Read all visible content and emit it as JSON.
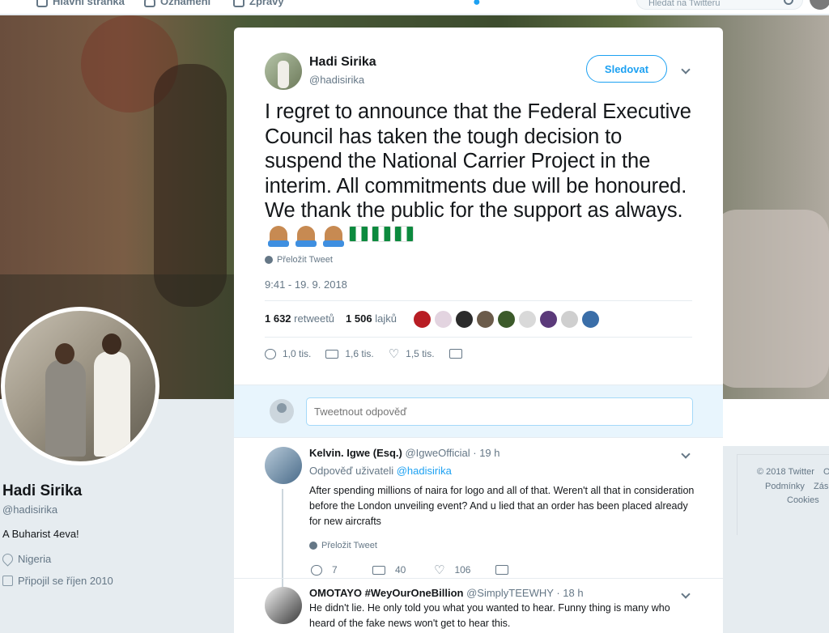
{
  "nav": {
    "home": "Hlavní stránka",
    "notifications": "Oznámení",
    "messages": "Zprávy",
    "search_placeholder": "Hledat na Twitteru"
  },
  "profile": {
    "name": "Hadi Sirika",
    "handle": "@hadisirika",
    "bio": "A Buharist 4eva!",
    "location": "Nigeria",
    "joined": "Připojil se říjen 2010"
  },
  "footer": {
    "line1": "© 2018 Twitter",
    "line1b": "O",
    "line2": "Podmínky",
    "line2b": "Zás",
    "line3": "Cookies"
  },
  "tweet": {
    "author_name": "Hadi Sirika",
    "author_handle": "@hadisirika",
    "follow_label": "Sledovat",
    "text": "I regret to announce that the Federal Executive Council has taken the tough decision to suspend the National Carrier Project in the interim. All commitments due will be honoured. We thank the public for the support as always.",
    "translate_label": "Přeložit Tweet",
    "timestamp": "9:41 - 19. 9. 2018",
    "retweets_count": "1 632",
    "retweets_label": "retweetů",
    "likes_count": "1 506",
    "likes_label": "lajků",
    "replies_action": "1,0 tis.",
    "retweets_action": "1,6 tis.",
    "likes_action": "1,5 tis.",
    "liker_colors": [
      "#b81d24",
      "#e3d4e0",
      "#2b2b2b",
      "#6b5b4a",
      "#3c5a2a",
      "#d9d9d9",
      "#5b3a7a",
      "#cfcfcf",
      "#3a6ea8"
    ]
  },
  "reply_box": {
    "placeholder": "Tweetnout odpověď"
  },
  "replies": [
    {
      "name": "Kelvin. Igwe (Esq.)",
      "handle": "@IgweOfficial",
      "time": "· 19 h",
      "replying_prefix": "Odpověď uživateli",
      "replying_to": "@hadisirika",
      "text": "After spending millions of naira for logo and all of that. Weren't all that in consideration before the London unveiling event? And u lied that an order has been placed already for new aircrafts",
      "translate_label": "Přeložit Tweet",
      "reply_count": "7",
      "retweet_count": "40",
      "like_count": "106"
    },
    {
      "name": "OMOTAYO #WeyOurOneBillion",
      "handle": "@SimplyTEEWHY",
      "time": "· 18 h",
      "text": "He didn't lie. He only told you what you wanted to hear. Funny thing is many who heard of the fake news won't get to hear this."
    }
  ]
}
